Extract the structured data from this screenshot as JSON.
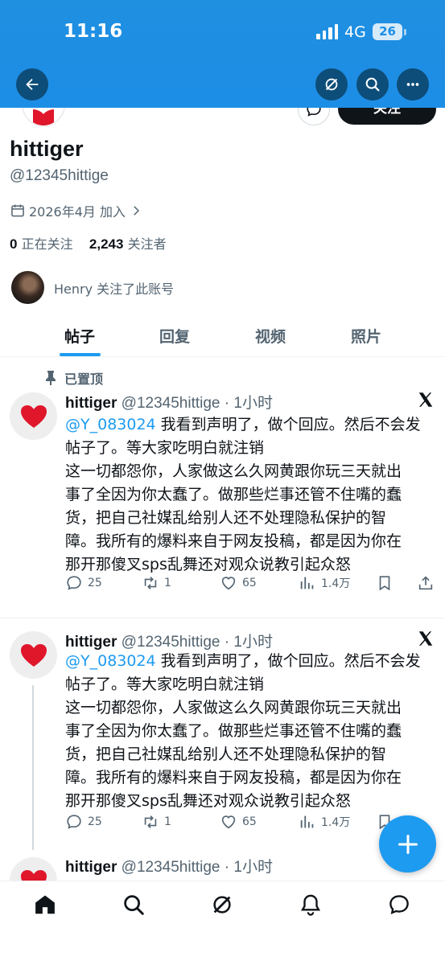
{
  "status_bar": {
    "time": "11:16",
    "network": "4G",
    "battery": "26"
  },
  "header": {
    "back_icon": "back-arrow-icon",
    "grok_icon": "grok-icon",
    "search_icon": "search-icon",
    "more_icon": "more-icon"
  },
  "profile": {
    "follow_label": "关注",
    "name": "hittiger",
    "handle": "@12345hittige",
    "joined": "2026年4月 加入",
    "following_count": "0",
    "following_label": "正在关注",
    "followers_count": "2,243",
    "followers_label": "关注者",
    "followed_by": "Henry 关注了此账号"
  },
  "tabs": [
    {
      "label": "帖子"
    },
    {
      "label": "回复"
    },
    {
      "label": "视频"
    },
    {
      "label": "照片"
    }
  ],
  "pinned_label": "已置顶",
  "posts": [
    {
      "name": "hittiger",
      "handle_time": "@12345hittige · 1小时",
      "mention": "@Y_083024",
      "line1": " 我看到声明了，做个回应。然后不会发",
      "lines": [
        "帖子了。等大家吃明白就注销",
        "这一切都怨你，人家做这么久网黄跟你玩三天就出",
        "事了全因为你太蠢了。做那些烂事还管不住嘴的蠢",
        "货，把自己社媒乱给别人还不处理隐私保护的智",
        "障。我所有的爆料来自于网友投稿，都是因为你在",
        "那开那傻叉sps乱舞还对观众说教引起众怒"
      ],
      "replies": "25",
      "reposts": "1",
      "likes": "65",
      "views": "1.4万"
    },
    {
      "name": "hittiger",
      "handle_time": "@12345hittige · 1小时",
      "mention": "@Y_083024",
      "line1": " 我看到声明了，做个回应。然后不会发",
      "lines": [
        "帖子了。等大家吃明白就注销",
        "这一切都怨你，人家做这么久网黄跟你玩三天就出",
        "事了全因为你太蠢了。做那些烂事还管不住嘴的蠢",
        "货，把自己社媒乱给别人还不处理隐私保护的智",
        "障。我所有的爆料来自于网友投稿，都是因为你在",
        "那开那傻叉sps乱舞还对观众说教引起众怒"
      ],
      "replies": "25",
      "reposts": "1",
      "likes": "65",
      "views": "1.4万"
    },
    {
      "name": "hittiger",
      "handle_time": "@12345hittige · 1小时"
    }
  ],
  "nav": [
    "home-icon",
    "search-icon",
    "grok-icon",
    "notifications-icon",
    "messages-icon"
  ],
  "colors": {
    "accent": "#1d9bf0",
    "header_blue": "#1d8ee6",
    "text": "#0f1419",
    "muted": "#536471"
  }
}
